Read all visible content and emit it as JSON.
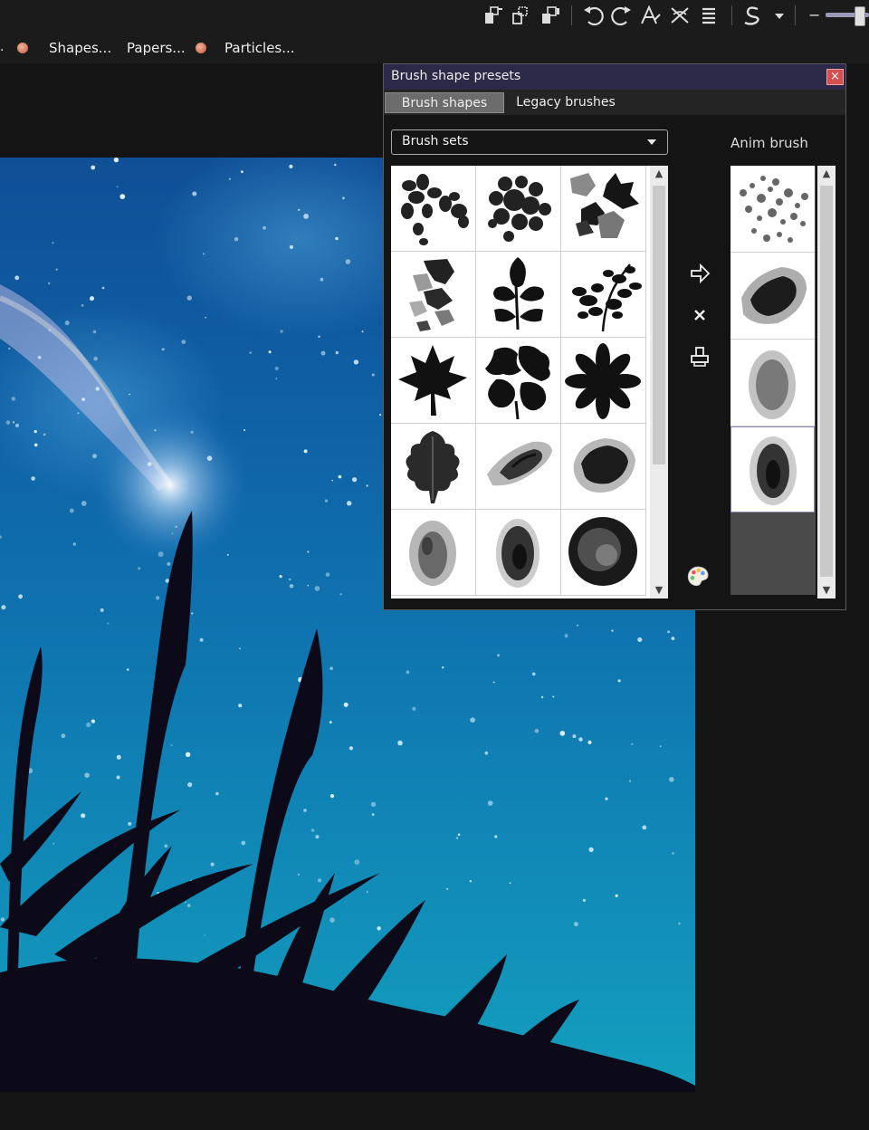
{
  "menu": {
    "items": [
      {
        "label": "Shapes..."
      },
      {
        "label": "Papers..."
      },
      {
        "label": "Particles..."
      }
    ]
  },
  "toolbar": {
    "icons": [
      "paste-icon",
      "duplicate-icon",
      "layer-icon",
      "undo-icon",
      "redo-icon",
      "text-icon",
      "transform-icon",
      "align-icon",
      "stroke-icon",
      "dropdown-icon"
    ],
    "zoom_minus": "−"
  },
  "panel": {
    "title": "Brush shape presets",
    "close": "×",
    "tabs": [
      {
        "label": "Brush shapes",
        "active": true
      },
      {
        "label": "Legacy brushes",
        "active": false
      }
    ],
    "brush_sets": {
      "selected": "Brush sets"
    },
    "anim_label": "Anim brush",
    "grid": [
      {
        "name": "petals-cluster"
      },
      {
        "name": "round-leaves-cluster"
      },
      {
        "name": "autumn-leaves-cluster"
      },
      {
        "name": "torn-leaves"
      },
      {
        "name": "leaf-sprig"
      },
      {
        "name": "foliage-branch"
      },
      {
        "name": "maple-leaf"
      },
      {
        "name": "oak-leaves"
      },
      {
        "name": "daisy-flower"
      },
      {
        "name": "oak-leaf"
      },
      {
        "name": "charcoal-smudge"
      },
      {
        "name": "dark-smudge"
      },
      {
        "name": "grey-sponge"
      },
      {
        "name": "dark-sponge"
      },
      {
        "name": "round-sponge"
      }
    ],
    "anim": [
      {
        "name": "scattered-flakes"
      },
      {
        "name": "dark-stroke"
      },
      {
        "name": "grey-texture"
      },
      {
        "name": "dark-texture"
      }
    ],
    "side_buttons": [
      "add-arrow-icon",
      "remove-x-icon",
      "stamp-icon",
      "palette-icon"
    ]
  },
  "colors": {
    "panel_title_bg": "#2c2847",
    "sky_top": "#0f4f96",
    "sky_bottom": "#139fbe",
    "close_button": "#d25050"
  }
}
